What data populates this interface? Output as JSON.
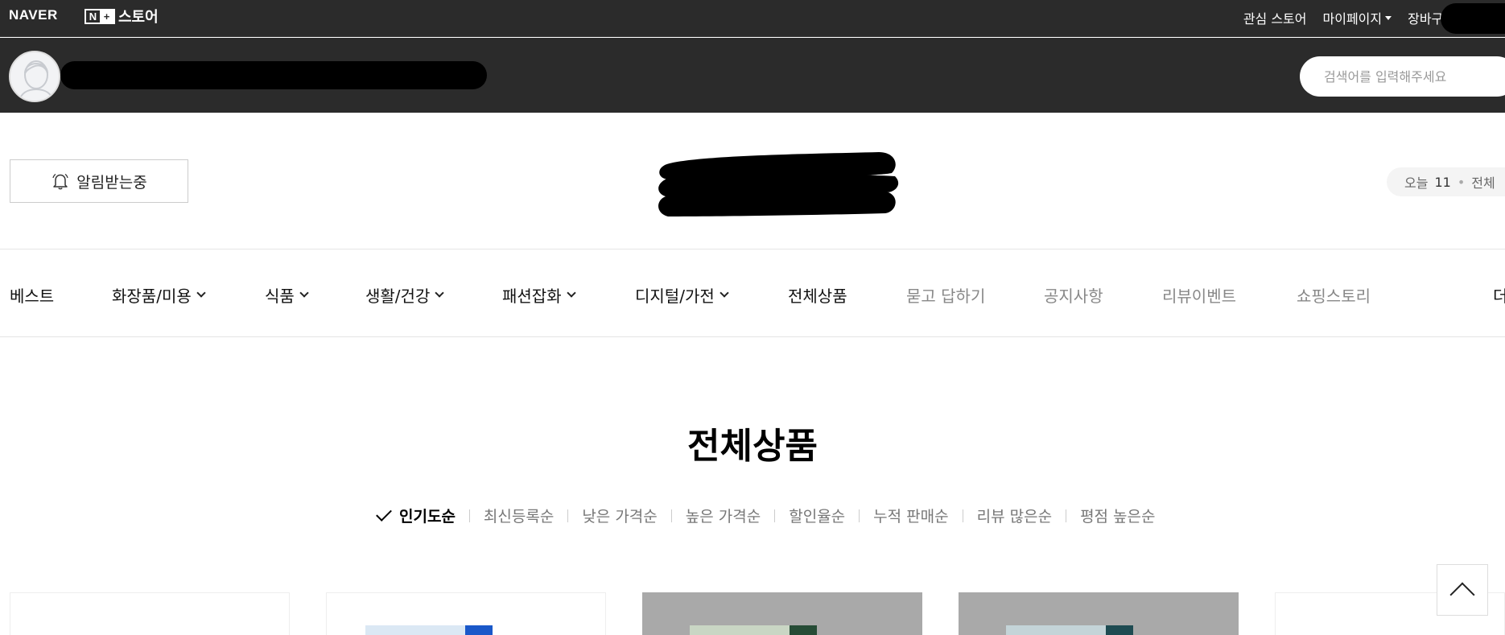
{
  "gnb": {
    "naver_logo": "NAVER",
    "store_logo_n": "N",
    "store_logo_plus": "+",
    "store_logo_text": "스토어",
    "links": [
      "관심 스토어",
      "마이페이지",
      "장바구니"
    ]
  },
  "header": {
    "search_placeholder": "검색어를 입력해주세요"
  },
  "alert": {
    "label": "알림받는중"
  },
  "visits": {
    "today_label": "오늘",
    "today_count": "11",
    "separator": "•",
    "total_label": "전체"
  },
  "nav": {
    "items": [
      {
        "label": "베스트"
      },
      {
        "label": "화장품/미용"
      },
      {
        "label": "식품"
      },
      {
        "label": "생활/건강"
      },
      {
        "label": "패션잡화"
      },
      {
        "label": "디지털/가전"
      },
      {
        "label": "전체상품"
      },
      {
        "label": "묻고 답하기"
      },
      {
        "label": "공지사항"
      },
      {
        "label": "리뷰이벤트"
      },
      {
        "label": "쇼핑스토리"
      },
      {
        "label": "더"
      }
    ]
  },
  "section": {
    "title": "전체상품"
  },
  "sort": {
    "options": [
      "인기도순",
      "최신등록순",
      "낮은 가격순",
      "높은 가격순",
      "할인율순",
      "누적 판매순",
      "리뷰 많은순",
      "평점 높은순"
    ],
    "selected": "인기도순"
  },
  "colors": {
    "header_bg": "#2b2b2b",
    "text_muted": "#888888",
    "accent_blue": "#1a58c9"
  }
}
